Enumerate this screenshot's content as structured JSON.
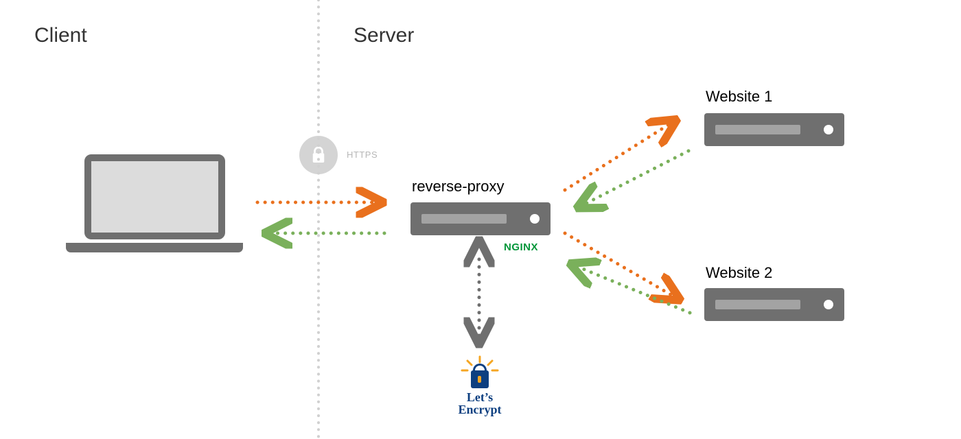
{
  "sections": {
    "client_label": "Client",
    "server_label": "Server"
  },
  "nodes": {
    "client": {
      "name": "client-laptop"
    },
    "reverse_proxy": {
      "label": "reverse-proxy",
      "tech_label": "NGINX"
    },
    "website1": {
      "label": "Website 1"
    },
    "website2": {
      "label": "Website 2"
    }
  },
  "security": {
    "protocol_label": "HTTPS",
    "ca": {
      "line1": "Let’s",
      "line2": "Encrypt"
    }
  },
  "colors": {
    "request": "#e9701d",
    "response": "#7ab05b",
    "neutral": "#6f6f6f",
    "divider": "#d0d0d0",
    "nginx": "#009639",
    "le_blue": "#0d3f80",
    "le_gold": "#f5a623"
  },
  "connections": [
    {
      "from": "client",
      "to": "reverse-proxy",
      "kind": "request"
    },
    {
      "from": "reverse-proxy",
      "to": "client",
      "kind": "response"
    },
    {
      "from": "reverse-proxy",
      "to": "website1",
      "kind": "request"
    },
    {
      "from": "website1",
      "to": "reverse-proxy",
      "kind": "response"
    },
    {
      "from": "reverse-proxy",
      "to": "website2",
      "kind": "request"
    },
    {
      "from": "website2",
      "to": "reverse-proxy",
      "kind": "response"
    },
    {
      "from": "reverse-proxy",
      "to": "letsencrypt",
      "kind": "bidirectional"
    }
  ]
}
